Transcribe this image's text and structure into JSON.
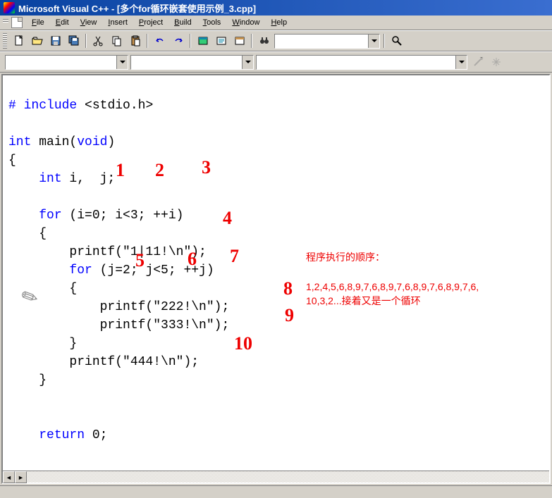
{
  "titlebar": {
    "text": "Microsoft Visual C++ - [多个for循环嵌套使用示例_3.cpp]"
  },
  "menu": {
    "file": "File",
    "edit": "Edit",
    "view": "View",
    "insert": "Insert",
    "project": "Project",
    "build": "Build",
    "tools": "Tools",
    "window": "Window",
    "help": "Help"
  },
  "code": {
    "l1_a": "# ",
    "l1_b": "include",
    "l1_c": " <stdio.h>",
    "l2": "",
    "l3_a": "int",
    "l3_b": " main(",
    "l3_c": "void",
    "l3_d": ")",
    "l4": "{",
    "l5_a": "    ",
    "l5_b": "int",
    "l5_c": " i,  j;",
    "l6": "",
    "l7_a": "    ",
    "l7_b": "for",
    "l7_c": " (i=0; i<3; ++i)",
    "l8": "    {",
    "l9": "        printf(\"1|11!\\n\");",
    "l10_a": "        ",
    "l10_b": "for",
    "l10_c": " (j=2; j<5; ++j)",
    "l11": "        {",
    "l12": "            printf(\"222!\\n\");",
    "l13": "            printf(\"333!\\n\");",
    "l14": "        }",
    "l15": "        printf(\"444!\\n\");",
    "l16": "    }",
    "l17": "",
    "l18": "",
    "l19_a": "    ",
    "l19_b": "return",
    "l19_c": " 0;"
  },
  "annotations": {
    "n1": "1",
    "n2": "2",
    "n3": "3",
    "n4": "4",
    "n5": "5",
    "n6": "6",
    "n7": "7",
    "n8": "8",
    "n9": "9",
    "n10": "10",
    "text1": "程序执行的顺序：",
    "text2": "1,2,4,5,6,8,9,7,6,8,9,7,6,8,9,7,6,8,9,7,6,",
    "text3": "10,3,2...接着又是一个循环"
  },
  "status": {
    "text": ""
  }
}
